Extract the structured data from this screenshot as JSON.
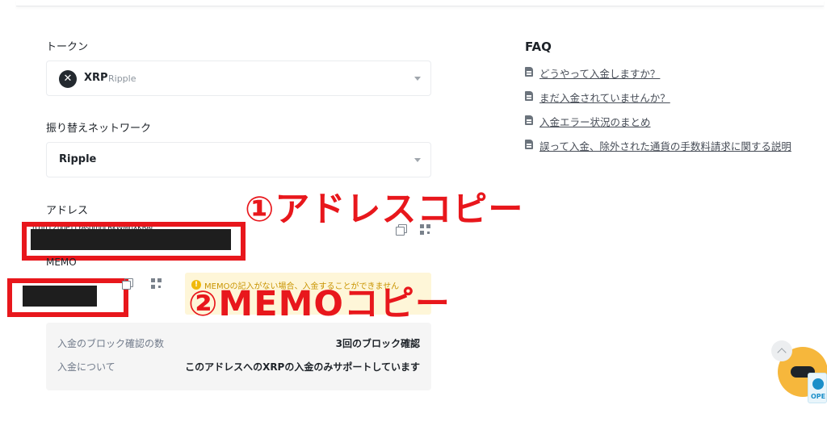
{
  "token": {
    "label": "トークン",
    "symbol": "XRP",
    "name": "Ripple",
    "logo_icon": "xrp-logo-icon"
  },
  "network": {
    "label": "振り替えネットワーク",
    "selected": "Ripple"
  },
  "address": {
    "label": "アドレス",
    "value": "rUTrLLZuqPTTYAsomnLRkWMnXKRAr"
  },
  "memo": {
    "label": "MEMO",
    "warning": "MEMOの記入がない場合、入金することができません"
  },
  "annotations": {
    "copy_address": "①アドレスコピー",
    "copy_memo": "②MEMOコピー"
  },
  "info": {
    "rows": [
      {
        "key": "入金のブロック確認の数",
        "value": "3回のブロック確認"
      },
      {
        "key": "入金について",
        "value": "このアドレスへのXRPの入金のみサポートしています"
      }
    ]
  },
  "faq": {
    "title": "FAQ",
    "items": [
      "どうやって入金しますか？",
      "まだ入金されていませんか？",
      "入金エラー状況のまとめ",
      "誤って入金、除外された通貨の手数料請求に関する説明"
    ]
  },
  "badge": {
    "text": "OPE"
  },
  "colors": {
    "annotation_red": "#e8171c",
    "warning_yellow": "#fef6d8",
    "fab_orange": "#f6b73c"
  }
}
